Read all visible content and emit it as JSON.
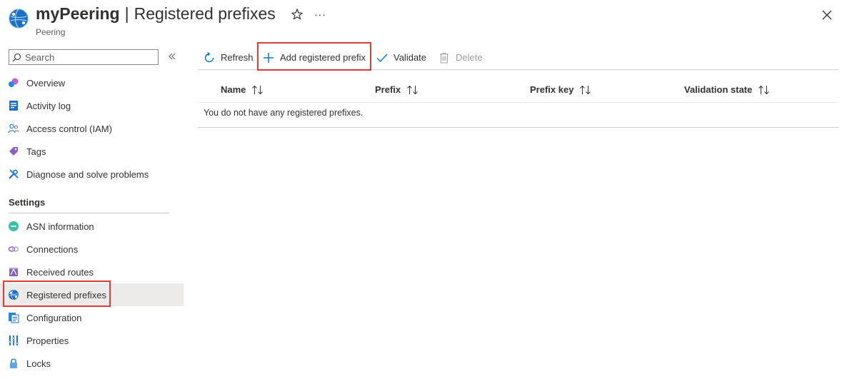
{
  "header": {
    "resource_name": "myPeering",
    "separator": "|",
    "page_title": "Registered prefixes",
    "resource_type": "Peering"
  },
  "sidebar": {
    "search_placeholder": "Search",
    "items": [
      {
        "label": "Overview",
        "icon": "overview-icon"
      },
      {
        "label": "Activity log",
        "icon": "activity-log-icon"
      },
      {
        "label": "Access control (IAM)",
        "icon": "iam-icon"
      },
      {
        "label": "Tags",
        "icon": "tag-icon"
      },
      {
        "label": "Diagnose and solve problems",
        "icon": "wrench-icon"
      }
    ],
    "settings_header": "Settings",
    "settings_items": [
      {
        "label": "ASN information",
        "icon": "asn-icon"
      },
      {
        "label": "Connections",
        "icon": "connections-icon"
      },
      {
        "label": "Received routes",
        "icon": "routes-icon"
      },
      {
        "label": "Registered prefixes",
        "icon": "globe-icon",
        "active": true
      },
      {
        "label": "Configuration",
        "icon": "configuration-icon"
      },
      {
        "label": "Properties",
        "icon": "properties-icon"
      },
      {
        "label": "Locks",
        "icon": "lock-icon"
      }
    ]
  },
  "toolbar": {
    "refresh": "Refresh",
    "add": "Add registered prefix",
    "validate": "Validate",
    "delete": "Delete"
  },
  "table": {
    "columns": [
      "Name",
      "Prefix",
      "Prefix key",
      "Validation state"
    ],
    "empty_message": "You do not have any registered prefixes."
  },
  "colors": {
    "accent": "#0078d4",
    "highlight": "#e03b3b",
    "active_bg": "#edebe9"
  }
}
